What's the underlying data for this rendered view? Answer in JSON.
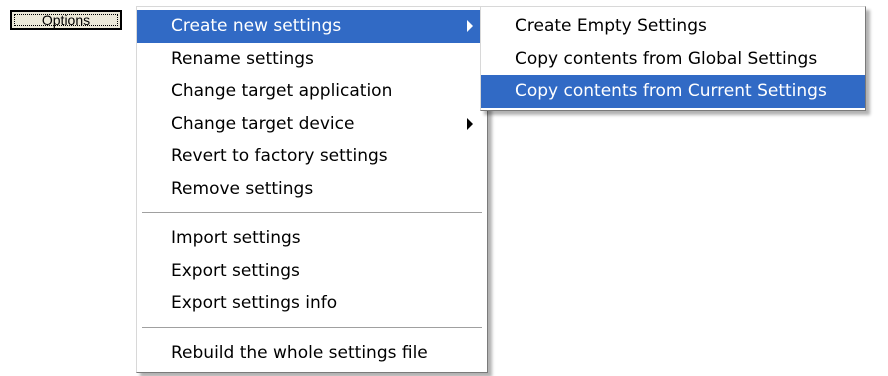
{
  "toolbar": {
    "options_label": "Options"
  },
  "main_menu": {
    "group1": [
      {
        "label": "Create new settings",
        "has_submenu": true,
        "highlighted": true
      },
      {
        "label": "Rename settings"
      },
      {
        "label": "Change target application"
      },
      {
        "label": "Change target device",
        "has_submenu": true
      },
      {
        "label": "Revert to factory settings"
      },
      {
        "label": "Remove settings"
      }
    ],
    "group2": [
      {
        "label": "Import settings"
      },
      {
        "label": "Export settings"
      },
      {
        "label": "Export settings info"
      }
    ],
    "group3": [
      {
        "label": "Rebuild the whole settings file"
      }
    ]
  },
  "sub_menu": {
    "items": [
      {
        "label": "Create Empty Settings"
      },
      {
        "label": "Copy contents from Global Settings"
      },
      {
        "label": "Copy contents from Current Settings",
        "highlighted": true
      }
    ]
  },
  "colors": {
    "highlight": "#316ac5",
    "button_face": "#ece9d8"
  }
}
